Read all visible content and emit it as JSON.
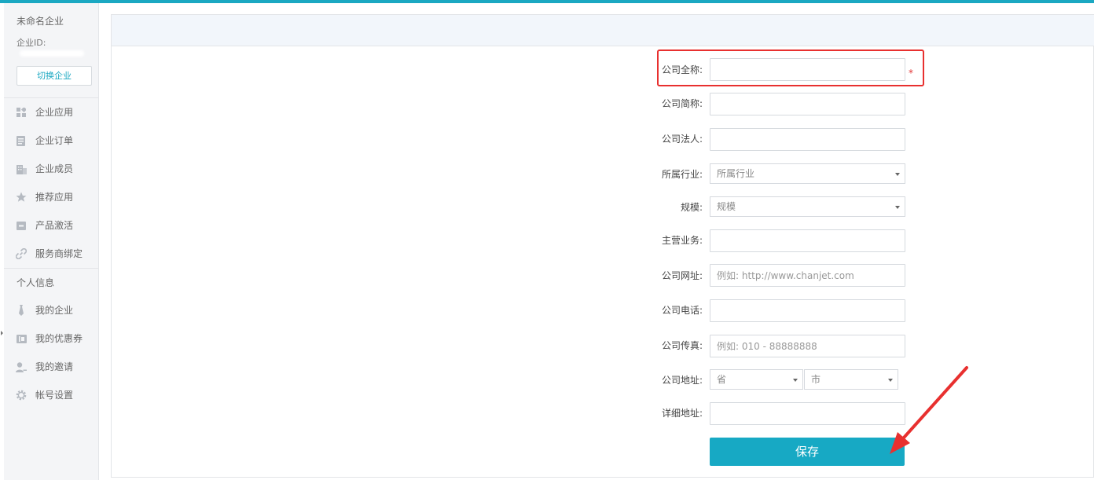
{
  "sidebar": {
    "company_name": "未命名企业",
    "company_id_label": "企业ID:",
    "switch_button": "切换企业",
    "menu": [
      {
        "label": "企业应用",
        "icon": "grid-icon"
      },
      {
        "label": "企业订单",
        "icon": "order-icon"
      },
      {
        "label": "企业成员",
        "icon": "building-icon"
      },
      {
        "label": "推荐应用",
        "icon": "star-icon"
      },
      {
        "label": "产品激活",
        "icon": "activate-icon"
      },
      {
        "label": "服务商绑定",
        "icon": "link-icon"
      }
    ],
    "personal_section": "个人信息",
    "personal_menu": [
      {
        "label": "我的企业",
        "icon": "tie-icon"
      },
      {
        "label": "我的优惠券",
        "icon": "coupon-icon"
      },
      {
        "label": "我的邀请",
        "icon": "user-invite-icon"
      },
      {
        "label": "帐号设置",
        "icon": "gear-icon"
      }
    ]
  },
  "form": {
    "full_name": {
      "label": "公司全称:",
      "value": "",
      "required_mark": "*"
    },
    "short_name": {
      "label": "公司简称:",
      "value": ""
    },
    "legal_person": {
      "label": "公司法人:",
      "value": ""
    },
    "industry": {
      "label": "所属行业:",
      "selected": "所属行业"
    },
    "scale": {
      "label": "规模:",
      "selected": "规模"
    },
    "main_business": {
      "label": "主营业务:",
      "value": ""
    },
    "website": {
      "label": "公司网址:",
      "placeholder": "例如: http://www.chanjet.com"
    },
    "phone": {
      "label": "公司电话:",
      "value": ""
    },
    "fax": {
      "label": "公司传真:",
      "placeholder": "例如: 010 - 88888888"
    },
    "address": {
      "label": "公司地址:",
      "province": "省",
      "city": "市"
    },
    "detail_address": {
      "label": "详细地址:",
      "value": ""
    },
    "save_button": "保存"
  },
  "colors": {
    "accent": "#17a9c4",
    "highlight": "#e8302f"
  }
}
